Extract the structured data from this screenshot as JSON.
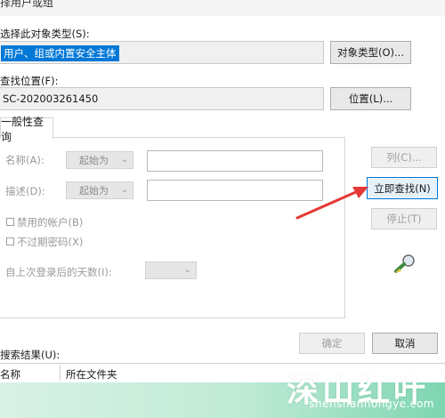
{
  "window": {
    "title": "择用户或组"
  },
  "object_type": {
    "label": "选择此对象类型(S):",
    "value": "用户、组或内置安全主体",
    "button": "对象类型(O)..."
  },
  "location": {
    "label": "查找位置(F):",
    "value": "SC-202003261450",
    "button": "位置(L)..."
  },
  "tabs": [
    {
      "label": "一般性查询"
    }
  ],
  "query": {
    "name_label": "名称(A):",
    "name_mode": "起始为",
    "desc_label": "描述(D):",
    "desc_mode": "起始为",
    "disabled_accounts": "禁用的帐户(B)",
    "no_expire_password": "不过期密码(X)",
    "days_since_login_label": "自上次登录后的天数(I):"
  },
  "side_buttons": {
    "columns": "列(C)...",
    "find_now": "立即查找(N)",
    "stop": "停止(T)"
  },
  "footer": {
    "ok": "确定",
    "cancel": "取消"
  },
  "results": {
    "label": "搜索结果(U):",
    "columns": [
      "名称",
      "所在文件夹"
    ]
  },
  "watermark": {
    "main": "深山红叶",
    "url": "shenshanhongye.com"
  },
  "colors": {
    "selection": "#0078d7",
    "arrow": "#e53935",
    "focus_border": "#0078d7"
  },
  "icons": {
    "search_icon": "magnifier-with-flashlight"
  }
}
